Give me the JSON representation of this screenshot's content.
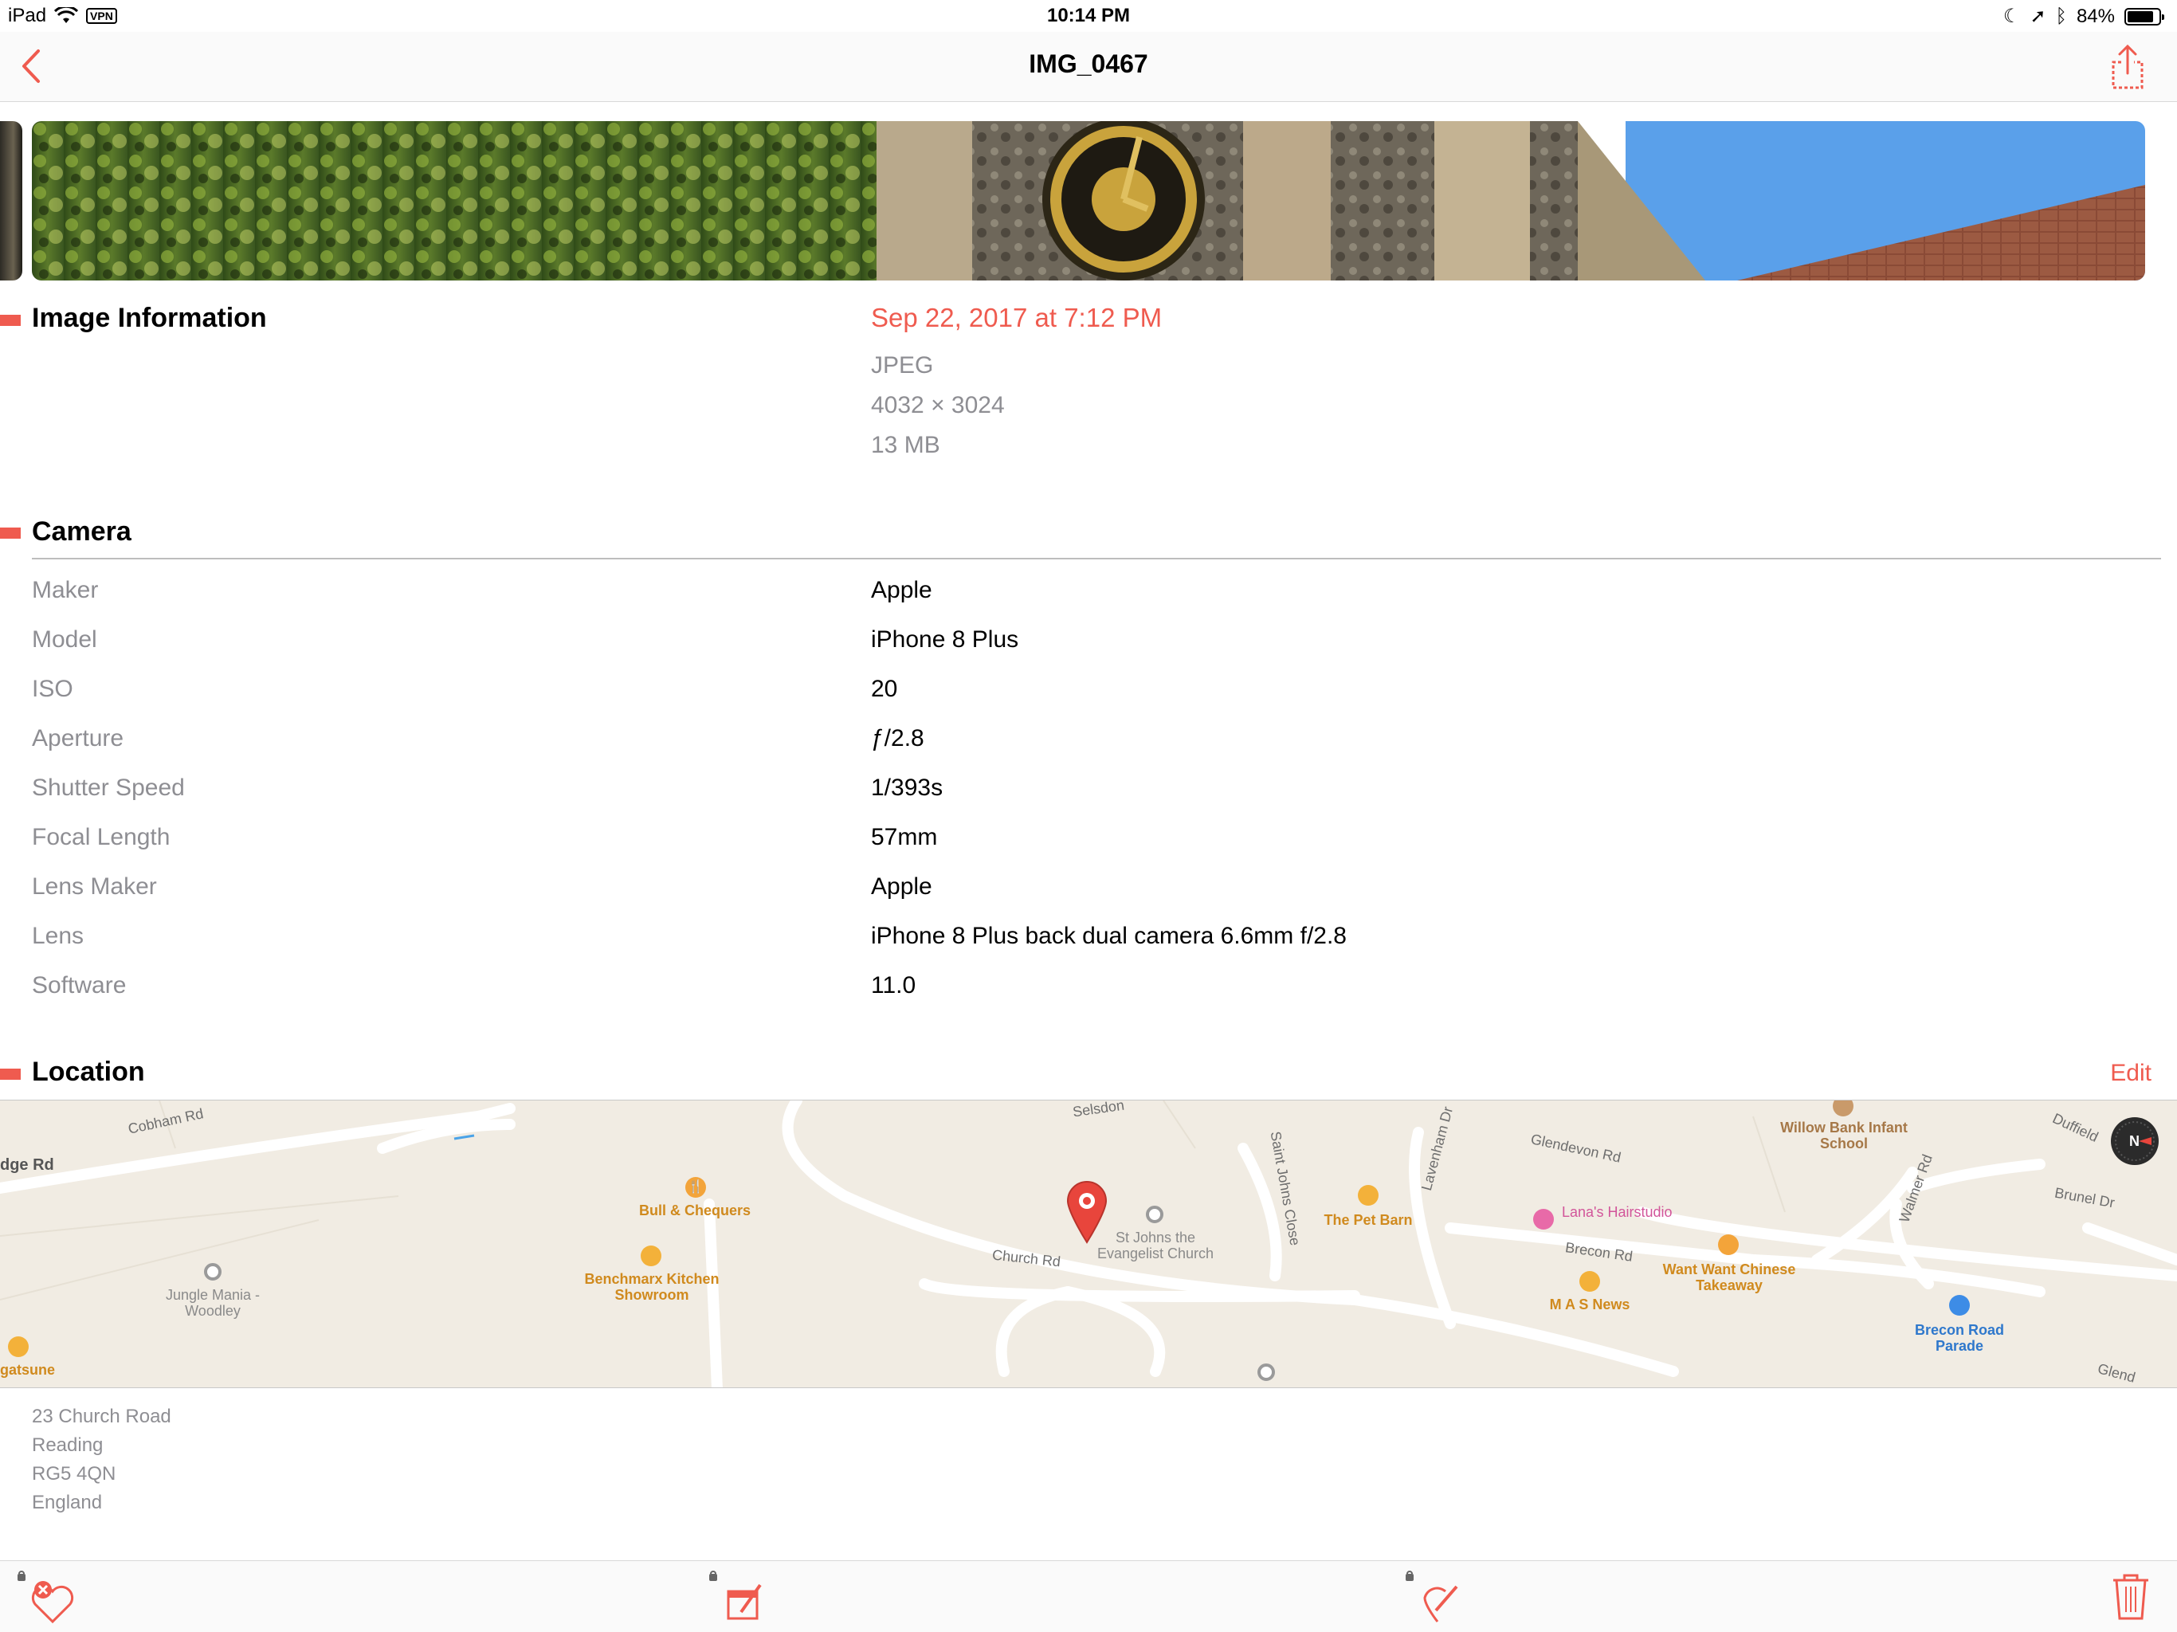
{
  "status_bar": {
    "device": "iPad",
    "vpn": "VPN",
    "time": "10:14 PM",
    "battery": "84%",
    "battery_level": 0.84
  },
  "nav": {
    "title": "IMG_0467",
    "back_icon": "chevron-left-icon",
    "share_icon": "share-icon"
  },
  "colors": {
    "accent": "#ef5b4f",
    "secondary_text": "#8e8e93"
  },
  "image_information": {
    "heading": "Image Information",
    "date": "Sep 22, 2017 at 7:12 PM",
    "format": "JPEG",
    "dimensions": "4032 × 3024",
    "size": "13 MB"
  },
  "camera": {
    "heading": "Camera",
    "rows": [
      {
        "label": "Maker",
        "value": "Apple"
      },
      {
        "label": "Model",
        "value": "iPhone 8 Plus"
      },
      {
        "label": "ISO",
        "value": "20"
      },
      {
        "label": "Aperture",
        "value": "ƒ/2.8"
      },
      {
        "label": "Shutter Speed",
        "value": "1/393s"
      },
      {
        "label": "Focal Length",
        "value": "57mm"
      },
      {
        "label": "Lens Maker",
        "value": "Apple"
      },
      {
        "label": "Lens",
        "value": "iPhone 8 Plus back dual camera 6.6mm f/2.8"
      },
      {
        "label": "Software",
        "value": "11.0"
      }
    ]
  },
  "location": {
    "heading": "Location",
    "edit_label": "Edit",
    "map": {
      "roads": [
        "Cobham Rd",
        "dge Rd",
        "Selsdon",
        "Church Rd",
        "Saint Johns Close",
        "Lavenham Dr",
        "Glendevon Rd",
        "Brecon Rd",
        "Walmer Rd",
        "Brunel Dr",
        "Duffield",
        "Glend"
      ],
      "pois": [
        {
          "name": "Bull & Chequers"
        },
        {
          "name": "Benchmarx Kitchen Showroom"
        },
        {
          "name": "Jungle Mania - Woodley"
        },
        {
          "name": "gatsune"
        },
        {
          "name": "St Johns the Evangelist Church"
        },
        {
          "name": "The Pet Barn"
        },
        {
          "name": "Lana's Hairstudio"
        },
        {
          "name": "M A S News"
        },
        {
          "name": "Want Want Chinese Takeaway"
        },
        {
          "name": "Willow Bank Infant School"
        },
        {
          "name": "Brecon Road Parade"
        }
      ]
    },
    "address": [
      "23 Church Road",
      "Reading",
      "RG5 4QN",
      "England"
    ]
  },
  "toolbar": {
    "icons": [
      "heart-remove-icon",
      "edit-date-icon",
      "edit-location-icon",
      "trash-icon"
    ]
  }
}
